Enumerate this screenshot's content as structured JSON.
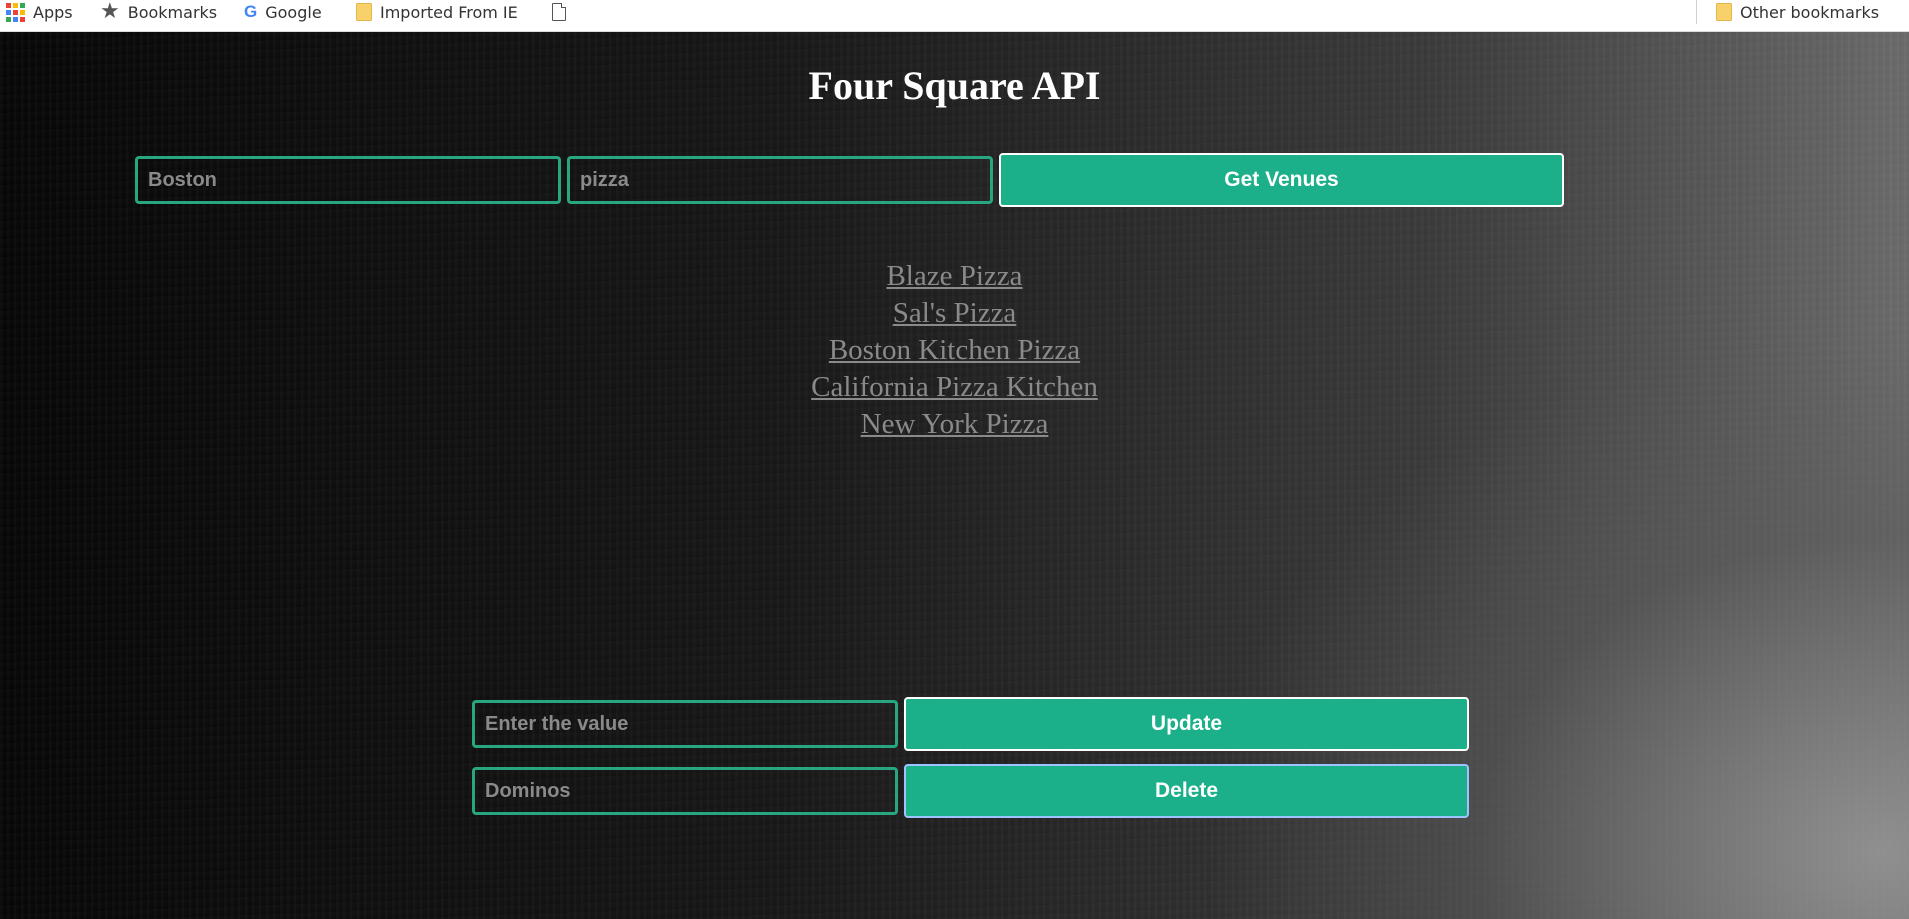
{
  "bookmarks": {
    "apps": "Apps",
    "bookmarks": "Bookmarks",
    "google": "Google",
    "google_glyph": "G",
    "imported": "Imported From IE",
    "other": "Other bookmarks"
  },
  "page": {
    "title": "Four Square API"
  },
  "search": {
    "city_value": "Boston",
    "query_value": "pizza",
    "button_label": "Get Venues"
  },
  "venues": [
    "Blaze Pizza",
    "Sal's Pizza",
    "Boston Kitchen Pizza",
    "California Pizza Kitchen",
    "New York Pizza"
  ],
  "update": {
    "placeholder": "Enter the value",
    "button_label": "Update"
  },
  "delete": {
    "value": "Dominos",
    "button_label": "Delete"
  },
  "colors": {
    "accent": "#1bb089",
    "field_border": "#27a67f",
    "link_text": "#8a8a8a"
  }
}
